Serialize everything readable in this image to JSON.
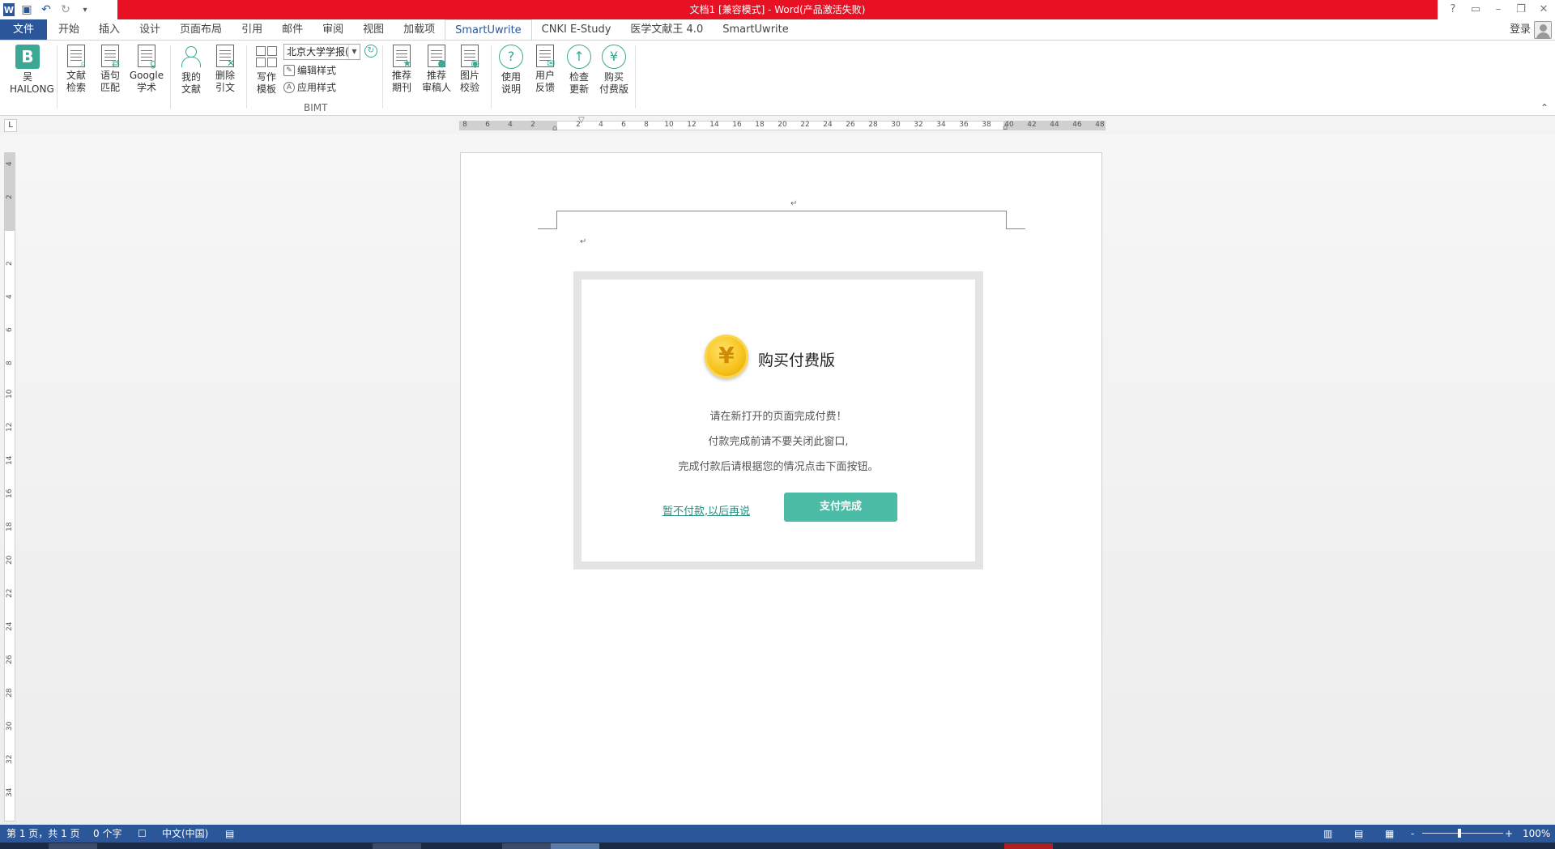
{
  "window": {
    "title": "文档1 [兼容模式] -  Word(产品激活失败)",
    "controls": [
      "?",
      "▭",
      "–",
      "❐",
      "✕"
    ]
  },
  "qat": {
    "word_icon": "word-icon",
    "save_icon": "save-icon",
    "undo_icon": "undo-icon",
    "redo_icon": "redo-icon"
  },
  "tabs": {
    "file": "文件",
    "items": [
      "开始",
      "插入",
      "设计",
      "页面布局",
      "引用",
      "邮件",
      "审阅",
      "视图",
      "加载项",
      "SmartUwrite",
      "CNKI E-Study",
      "医学文献王 4.0",
      "SmartUwrite"
    ],
    "active_index": 9,
    "login": "登录"
  },
  "ribbon": {
    "user": {
      "line1": "吴",
      "line2": "HAILONG",
      "badge": "B"
    },
    "buttons": [
      {
        "l1": "文献",
        "l2": "检索"
      },
      {
        "l1": "语句",
        "l2": "匹配"
      },
      {
        "l1": "Google",
        "l2": "学术"
      },
      {
        "l1": "我的",
        "l2": "文献"
      },
      {
        "l1": "删除",
        "l2": "引文"
      },
      {
        "l1": "写作",
        "l2": "模板"
      }
    ],
    "style_combo": "北京大学学报(",
    "edit_style": "编辑样式",
    "apply_style": "应用样式",
    "group_label": "BIMT",
    "right_buttons": [
      {
        "l1": "推荐",
        "l2": "期刊"
      },
      {
        "l1": "推荐",
        "l2": "审稿人"
      },
      {
        "l1": "图片",
        "l2": "校验"
      },
      {
        "l1": "使用",
        "l2": "说明"
      },
      {
        "l1": "用户",
        "l2": "反馈"
      },
      {
        "l1": "检查",
        "l2": "更新"
      },
      {
        "l1": "购买",
        "l2": "付费版"
      }
    ],
    "circle_glyphs": {
      "help": "?",
      "update": "↑",
      "buy": "¥"
    }
  },
  "ruler": {
    "h_numbers": [
      "8",
      "6",
      "4",
      "2",
      "",
      "2",
      "4",
      "6",
      "8",
      "10",
      "12",
      "14",
      "16",
      "18",
      "20",
      "22",
      "24",
      "26",
      "28",
      "30",
      "32",
      "34",
      "36",
      "38",
      "40",
      "42",
      "44",
      "46",
      "48"
    ],
    "v_numbers": [
      "4",
      "2",
      "",
      "2",
      "4",
      "6",
      "8",
      "10",
      "12",
      "14",
      "16",
      "18",
      "20",
      "22",
      "24",
      "26",
      "28",
      "30",
      "32",
      "34"
    ],
    "tab_selector": "L"
  },
  "document": {
    "paragraph_mark": "↵"
  },
  "dialog": {
    "coin_symbol": "¥",
    "title": "购买付费版",
    "line1": "请在新打开的页面完成付费！",
    "line2": "付款完成前请不要关闭此窗口,",
    "line3": "完成付款后请根据您的情况点击下面按钮。",
    "later_link": "暂不付款,以后再说",
    "done_button": "支付完成"
  },
  "status": {
    "page": "第 1 页，共 1 页",
    "words": "0 个字",
    "lang": "中文(中国)",
    "zoom_minus": "-",
    "zoom_plus": "+",
    "zoom": "100%"
  }
}
